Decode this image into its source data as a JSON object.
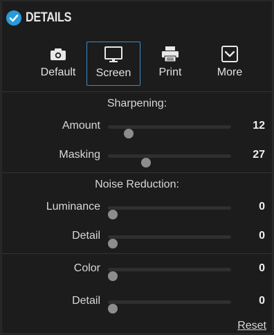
{
  "header": {
    "title": "DETAILS"
  },
  "modes": [
    {
      "label": "Default",
      "icon": "camera-icon"
    },
    {
      "label": "Screen",
      "icon": "monitor-icon",
      "active": true
    },
    {
      "label": "Print",
      "icon": "printer-icon"
    },
    {
      "label": "More",
      "icon": "chevron-down-box-icon"
    }
  ],
  "sharpening": {
    "title": "Sharpening:",
    "sliders": [
      {
        "label": "Amount",
        "value": "12",
        "level": 0.14
      },
      {
        "label": "Masking",
        "value": "27",
        "level": 0.29
      }
    ]
  },
  "noise_reduction": {
    "title": "Noise Reduction:",
    "sliders": [
      {
        "label": "Luminance",
        "value": "0",
        "level": 0
      },
      {
        "label": "Detail",
        "value": "0",
        "level": 0
      }
    ],
    "color_sliders": [
      {
        "label": "Color",
        "value": "0",
        "level": 0
      },
      {
        "label": "Detail",
        "value": "0",
        "level": 0
      }
    ]
  },
  "reset_label": "Reset",
  "colors": {
    "accent": "#2a9bd8",
    "active_border": "#3a8ec9",
    "background": "#1c1c1c"
  }
}
